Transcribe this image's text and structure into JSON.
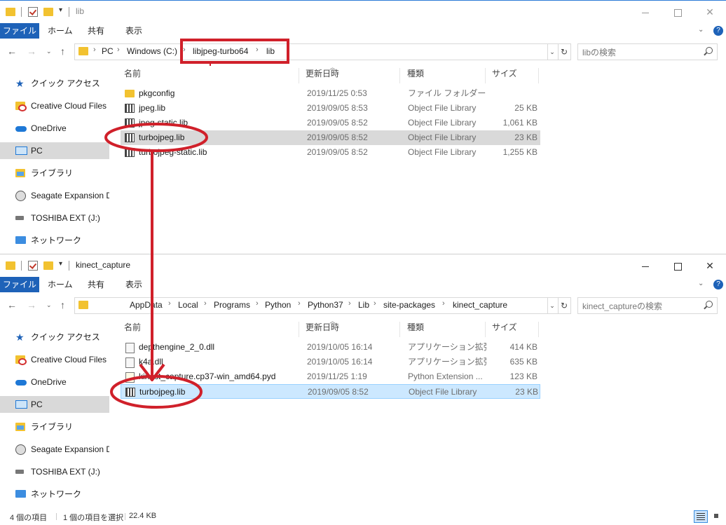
{
  "colors": {
    "accent": "#1e62b8",
    "annotation": "#d0202a",
    "selection_gray": "#d9d9d9",
    "selection_blue": "#cce8ff"
  },
  "ribbon": {
    "file": "ファイル",
    "home": "ホーム",
    "share": "共有",
    "view": "表示"
  },
  "columns": {
    "name": "名前",
    "date": "更新日時",
    "type": "種類",
    "size": "サイズ"
  },
  "sidebar": [
    {
      "label": "クイック アクセス",
      "icon": "star-icon"
    },
    {
      "label": "Creative Cloud Files",
      "icon": "creative-cloud-icon"
    },
    {
      "label": "OneDrive",
      "icon": "onedrive-icon"
    },
    {
      "label": "PC",
      "icon": "pc-icon"
    },
    {
      "label": "ライブラリ",
      "icon": "library-icon"
    },
    {
      "label": "Seagate Expansion Dr",
      "icon": "drive-icon"
    },
    {
      "label": "TOSHIBA EXT (J:)",
      "icon": "usb-drive-icon"
    },
    {
      "label": "ネットワーク",
      "icon": "network-icon"
    }
  ],
  "window1": {
    "title": "lib",
    "breadcrumb": [
      "PC",
      "Windows (C:)",
      "libjpeg-turbo64",
      "lib"
    ],
    "search_placeholder": "libの検索",
    "files": [
      {
        "name": "pkgconfig",
        "date": "2019/11/25 0:53",
        "type": "ファイル フォルダー",
        "size": ""
      },
      {
        "name": "jpeg.lib",
        "date": "2019/09/05 8:53",
        "type": "Object File Library",
        "size": "25 KB"
      },
      {
        "name": "jpeg-static.lib",
        "date": "2019/09/05 8:52",
        "type": "Object File Library",
        "size": "1,061 KB"
      },
      {
        "name": "turbojpeg.lib",
        "date": "2019/09/05 8:52",
        "type": "Object File Library",
        "size": "23 KB"
      },
      {
        "name": "turbojpeg-static.lib",
        "date": "2019/09/05 8:52",
        "type": "Object File Library",
        "size": "1,255 KB"
      }
    ]
  },
  "window2": {
    "title": "kinect_capture",
    "breadcrumb": [
      "AppData",
      "Local",
      "Programs",
      "Python",
      "Python37",
      "Lib",
      "site-packages",
      "kinect_capture"
    ],
    "search_placeholder": "kinect_captureの検索",
    "files": [
      {
        "name": "depthengine_2_0.dll",
        "date": "2019/10/05 16:14",
        "type": "アプリケーション拡張",
        "size": "414 KB"
      },
      {
        "name": "k4a.dll",
        "date": "2019/10/05 16:14",
        "type": "アプリケーション拡張",
        "size": "635 KB"
      },
      {
        "name": "kinect_capture.cp37-win_amd64.pyd",
        "date": "2019/11/25 1:19",
        "type": "Python Extension ...",
        "size": "123 KB"
      },
      {
        "name": "turbojpeg.lib",
        "date": "2019/09/05 8:52",
        "type": "Object File Library",
        "size": "23 KB"
      }
    ]
  },
  "status": {
    "item_count": "4 個の項目",
    "selected": "1 個の項目を選択",
    "selected_size": "22.4 KB"
  }
}
